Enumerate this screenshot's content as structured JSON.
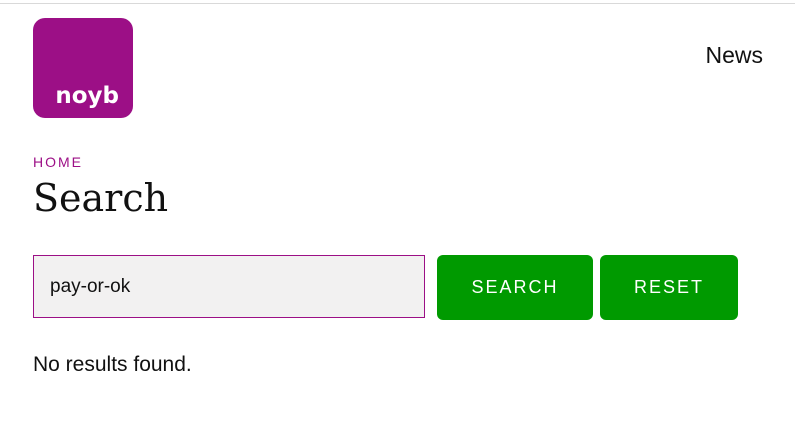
{
  "header": {
    "logo_text": "noyb",
    "nav_news": "News"
  },
  "breadcrumb": {
    "home": "HOME"
  },
  "page": {
    "title": "Search"
  },
  "search": {
    "value": "pay-or-ok",
    "search_button": "SEARCH",
    "reset_button": "RESET"
  },
  "results": {
    "message": "No results found."
  },
  "colors": {
    "brand": "#9c0f86",
    "button": "#009a00",
    "input_background": "#f2f1f1"
  }
}
